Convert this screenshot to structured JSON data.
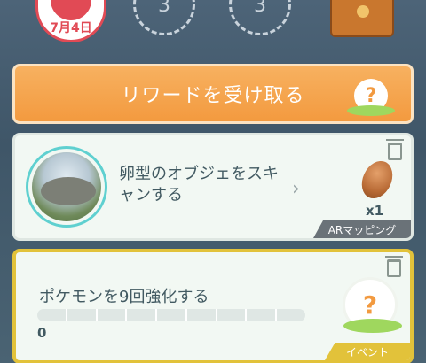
{
  "header": {
    "stamp_date": "7月4日",
    "step_a": "3",
    "step_b": "3"
  },
  "reward_button": {
    "label": "リワードを受け取る",
    "icon": "question-mark-icon",
    "badge_text": "?"
  },
  "task1": {
    "title": "卵型のオブジェをスキャンする",
    "reward_icon": "rock-icon",
    "reward_qty": "x1",
    "tag": "ARマッピング",
    "chevron": "›"
  },
  "task2": {
    "title": "ポケモンを9回強化する",
    "progress_value": "0",
    "progress_goal": 9,
    "tag": "イベント",
    "badge_text": "?"
  }
}
